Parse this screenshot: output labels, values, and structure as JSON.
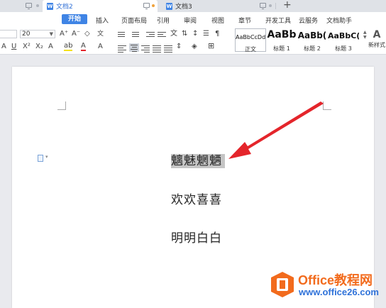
{
  "tabs": [
    {
      "label": "文档2",
      "doc_badge": "W",
      "active": true
    },
    {
      "label": "文档3",
      "doc_badge": "W",
      "active": false
    }
  ],
  "menu": {
    "items": [
      "开始",
      "插入",
      "页面布局",
      "引用",
      "审阅",
      "视图",
      "章节",
      "开发工具",
      "云服务",
      "文档助手"
    ],
    "active_index": 0
  },
  "ribbon": {
    "font_size": "20",
    "styles": [
      {
        "preview": "AaBbCcDd",
        "name": "正文"
      },
      {
        "preview": "AaBb",
        "name": "标题 1"
      },
      {
        "preview": "AaBb(",
        "name": "标题 2"
      },
      {
        "preview": "AaBbC(",
        "name": "标题 3"
      }
    ],
    "new_style_label": "新样式",
    "new_style_icon_text": "A",
    "grow_font": "A⁺",
    "shrink_font": "A⁻",
    "clear_format": "◇",
    "superscript": "X²",
    "subscript": "X₂",
    "font_color": "A",
    "highlight": "ab"
  },
  "document": {
    "lines": [
      "魑魅魍魉",
      "欢欢喜喜",
      "明明白白"
    ],
    "selected_line_index": 0
  },
  "watermark": {
    "brand": "Office教程网",
    "url": "www.office26.com"
  },
  "colors": {
    "accent": "#3f84e5",
    "arrow": "#e4252b",
    "watermark_orange": "#f26b1d",
    "watermark_blue": "#2f72d9"
  }
}
